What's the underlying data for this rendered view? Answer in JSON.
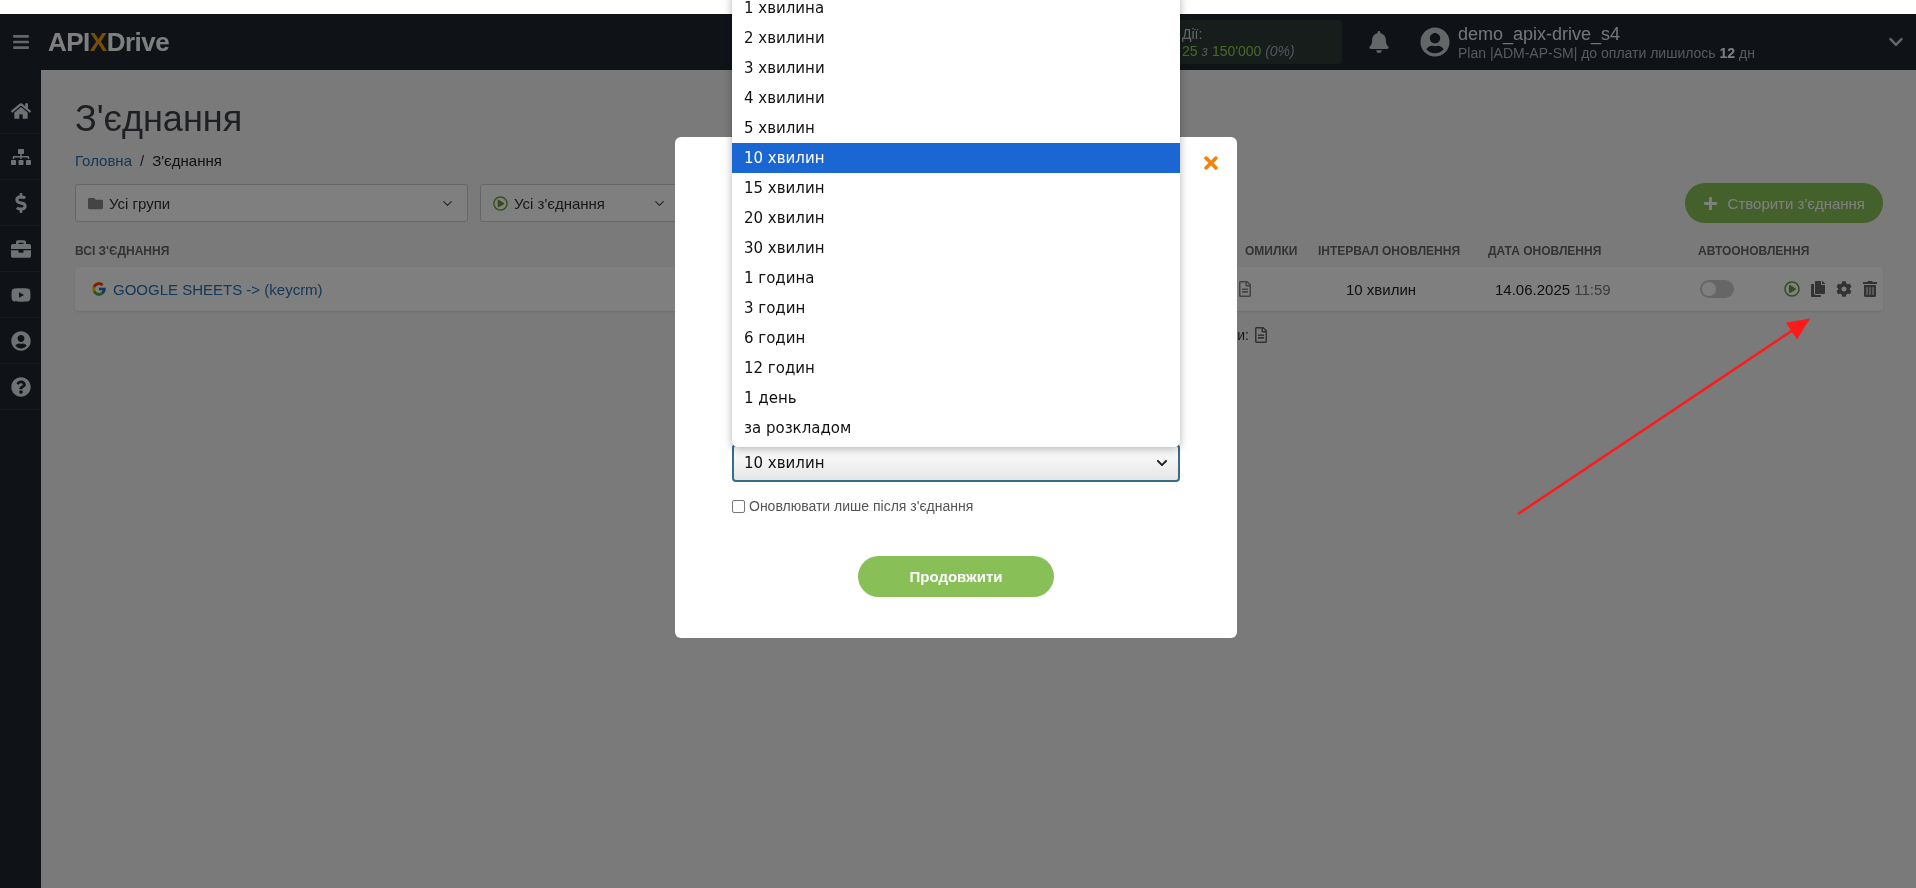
{
  "header": {
    "logo": [
      "API",
      "X",
      "Drive"
    ],
    "actions": {
      "label": "Дії:",
      "used": "25",
      "separator": "з",
      "limit": "150'000",
      "percent": "(0%)"
    },
    "user": {
      "name": "demo_apix-drive_s4",
      "plan": "Plan |ADM-AP-SM| до оплати лишилось **12** дн"
    }
  },
  "page": {
    "title": "З'єднання",
    "breadcrumb": [
      {
        "label": "Головна",
        "kind": "link"
      },
      {
        "label": "/",
        "kind": "separator"
      },
      {
        "label": "З'єднання",
        "kind": "current"
      }
    ],
    "filters": [
      {
        "kind": "group",
        "value": "Усі групи"
      },
      {
        "kind": "status",
        "value": "Усі з'єднання"
      }
    ],
    "create_button": "Створити з'єднання",
    "table": {
      "columns": [
        "ВСІ З'ЄДНАННЯ",
        "ОМИЛКИ",
        "ІНТЕРВАЛ ОНОВЛЕННЯ",
        "ДАТА ОНОВЛЕННЯ",
        "АВТООНОВЛЕННЯ"
      ],
      "rows": [
        {
          "name": "GOOGLE SHEETS -> (keycrm)",
          "interval": "10 хвилин",
          "date": "14.06.2025",
          "time": "11:59",
          "autoupdate": false
        }
      ]
    },
    "legend_fragment": "и:"
  },
  "modal": {
    "interval_options": [
      {
        "label": "1 хвилина",
        "selected": false
      },
      {
        "label": "2 хвилини",
        "selected": false
      },
      {
        "label": "3 хвилини",
        "selected": false
      },
      {
        "label": "4 хвилини",
        "selected": false
      },
      {
        "label": "5 хвилин",
        "selected": false
      },
      {
        "label": "10 хвилин",
        "selected": true
      },
      {
        "label": "15 хвилин",
        "selected": false
      },
      {
        "label": "20 хвилин",
        "selected": false
      },
      {
        "label": "30 хвилин",
        "selected": false
      },
      {
        "label": "1 година",
        "selected": false
      },
      {
        "label": "3 годин",
        "selected": false
      },
      {
        "label": "6 годин",
        "selected": false
      },
      {
        "label": "12 годин",
        "selected": false
      },
      {
        "label": "1 день",
        "selected": false
      },
      {
        "label": "за розкладом",
        "selected": false
      }
    ],
    "interval_value": "10 хвилин",
    "checkbox": {
      "label": "Оновлювати лише після з'єднання",
      "checked": false
    },
    "button": "Продовжити"
  }
}
